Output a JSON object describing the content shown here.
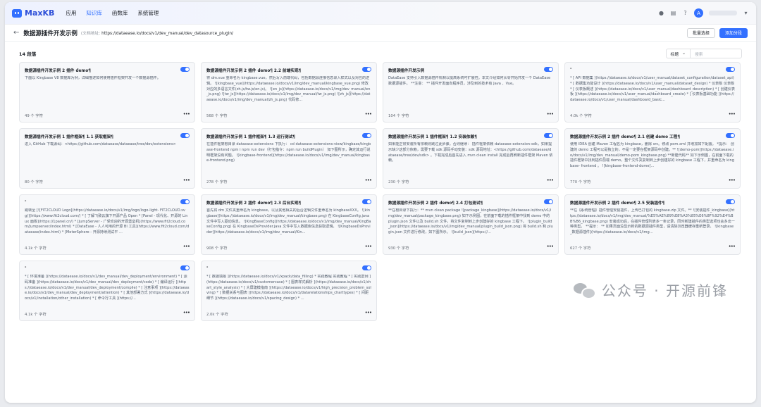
{
  "app": {
    "logo_text": "MaxKB",
    "brand_color": "#3370ff"
  },
  "nav": {
    "items": [
      "应用",
      "知识库",
      "函数库",
      "系统管理"
    ],
    "active_index": 1
  },
  "top_right": {
    "icons": [
      "github-icon",
      "document-icon",
      "help-icon"
    ],
    "avatar_initial": "A"
  },
  "header": {
    "title": "数据源插件开发示例",
    "subtitle_prefix": "(文档地址:",
    "doc_url": "https://dataease.io/docs/v1/dev_manual/dev_datasource_plugin/",
    "batch_button": "批量选择",
    "add_button": "添加分段"
  },
  "list": {
    "count_label": "14 段落",
    "filter_select": "标题",
    "search_placeholder": "搜索"
  },
  "cards": [
    {
      "title": "数据源插件开发示例 2 插件 demo¶",
      "body": "下面以 Kingbase V8 数据库为例，详细描述如何使用插件框架开发一个数据源插件。",
      "chars": "49 个 字符"
    },
    {
      "title": "数据源插件开发示例 2 插件 demo¶ 2.2 前端实现¶",
      "body": "将 dm.vue 重命名为 kingbase.vue，然后写入前端代码，包括数据源连接信息录入样式以及对应的逻辑。 ![kingbase_vue](https://dataease.io/docs/v1/img/dev_manual/kingbase_vue.png) 修改对应的多语言文件(zh.js/tw.js/en.js)。 ![en_js](https://dataease.io/docs/v1/img/dev_manual/en_js.png) ![tw_js](https://dataease.io/docs/v1/img/dev_manual/tw_js.png) ![zh_js](https://dataease.io/docs/v1/img/dev_manual/zh_js.png) 代码修...",
      "chars": "568 个 字符"
    },
    {
      "title": "数据源插件开发示例",
      "body": "DataEase 支持引入数据源插件机制以提高系统可扩展性。本文介绍如何从零开始开发一个 DataEase 数据源插件。 **注意： ** 插件开发面向程序员，涉及到的技术有 Java 、Vue。",
      "chars": "104 个 字符"
    },
    {
      "title": "-",
      "body": "* [ API 数据集 ](https://dataease.io/docs/v1/user_manual/dataset_configuration/dataset_api) * [ 数据集功能设计 ](https://dataease.io/docs/v1/user_manual/dataset_design) * 仪表板 仪表板 * [ 仪表板概述 ](https://dataease.io/docs/v1/user_manual/dashboard_description) * [ 创建仪表板 ](https://dataease.io/docs/v1/user_manual/dashboard_create) * [ 仪表板基础功能 ](https://dataease.io/docs/v1/user_manual/dashboard_basic...",
      "chars": "4.0k 个 字符"
    },
    {
      "title": "数据源插件开发示例 1 插件框架¶ 1.1 获取框架¶",
      "body": "进入 GitHub 下载源码：<https://github.com/dataease/dataease/tree/dev/extensions>",
      "chars": "80 个 字符"
    },
    {
      "title": "数据源插件开发示例 1 插件框架¶ 1.3 运行测试¶",
      "body": "在插件框架根目录 dataease-extensions 下执行： cd dataease-extensions-view/kingbase/kingbase-frontend npm i npm run dev（打包指令：npm run buildPlugin） 如下图所示，确定其运行说明框架没有问题。 ![kingbase-frontend](https://dataease.io/docs/v1/img/dev_manual/kingbase-frontend.png)",
      "chars": "278 个 字符"
    },
    {
      "title": "数据源插件开发示例 1 插件框架¶ 1.2 安装依赖¶",
      "body": "如果能正常安装所有依赖则跳过此步骤。否则继续： 插件框架依赖 dataease-extension-sdk，如果提示缺少这部分依赖，需要下载 sdk 源码手动安装：sdk 源码地址：<https://github.com/dataease/dataease/tree/dev/sdk> 。下载完成后首先进入 mvn clean install 完成后再刷新插件框架 Maven 依赖。",
      "chars": "230 个 字符"
    },
    {
      "title": "数据源插件开发示例 2 插件 demo¶ 2.1 创建 demo 工程¶",
      "body": "使用 IDEA 创建 Maven 工程名为 kingbase，删除 src。修改 pom.xml 并增加如下配置。 *提示： 创建的 demo 工程可以是独立的，不是一定要在框架源码中创建。** ![demo-pom](https://dataease.io/docs/v1/img/dev_manual/demo-pom_kingbase.png) **新建代码** 如下示例图，在前面下载的插件框架中找到插件前端 demo，整个文件夹复制到上步创建好的 kingbase 工程下，并重命名为 kingbase- frontend 。 ![kingbase-frontend-dome]...",
      "chars": "770 个 字符"
    },
    {
      "title": "-",
      "body": "跳转至 [![FIT2CLOUD Logo](https://dataease.io/docs/v1/img/logo/logo-light- FIT2CLOUD.svg)](https://www.fit2cloud.com/) * [ 了解飞致云旗下开源产品 Open * [Panel - 现代化、开源的 Linux 面板](https://1panel.cn/) * [JumpServer - 广受欢迎的开源堡垒机](https://www.fit2cloud.com/jumpserver/index.html) * [DataEase - 人人可用的开源 BI 工具](https://www.fit2cloud.com/dataease/index.html) * [MeterSphere - 开源持续测试平 ...",
      "chars": "4.1k 个 字符"
    },
    {
      "title": "数据源插件开发示例 2 插件 demo¶ 2.3 后台实现¶",
      "body": "首先将 dm 文件夹重命名为 kingbase，以及其他相关的后台逻辑文件重命名为 kingbaseXXX。 ![kingbase](https://dataease.io/docs/v1/img/dev_manual/kingbase.png) 在 KingbaseConfig.java 文件中写入驱动信息。 ![KingBaseConfig](https://dataease.io/docs/v1/img/dev_manual/KingBaseConfig.png) 在 KingbaseDsProvider.java 文件中写入数据库信息获取逻辑。 ![KingbaseDsProvider](https://dataease.io/docs/v1/img/dev_manual/Kin...",
      "chars": "908 个 字符"
    },
    {
      "title": "数据源插件开发示例 2 插件 demo¶ 2.4 打包测试¶",
      "body": "**在根目录下执行：** mvn clean package ![package_kingbase](https://dataease.io/docs/v1/img/dev_manual/package_kingbase.png) 如下示例图，在前面下载的插件框架中找到 demo 中的 plugin.json 文件以及 build.sh 文件，将文件复制到上步创建好的 kingbase 工程下。 ![plugin_build_json](https://dataease.io/docs/v1/img/dev_manual/plugin_build_json.png) 将 build.sh 和 plugin.json 文件进行修改，如下图所示。 ![build_json](https://...",
      "chars": "930 个 字符"
    },
    {
      "title": "数据源插件开发示例 2 插件 demo¶ 2.5 安装插件¶",
      "body": "**在【系统管理】插件管理安装插件，上传已打包的 kingbase.zip 文件。** ![安装插件_kingbase](https://dataease.io/docs/v1/img/dev_manual/%E5%AE%89%E8%A3%85%E6%8F%92%E4%BB%B6_kingbase.png) 安装成功后，在插件管理列表多一条记录，同时新建插件的类型选项也会多出一种类型。 **提示： ** 如果页面没显示新的数据源插件类型，请清除浏览器缓存重新登录。 ![kingbase_数据源插件](https://dataease.io/docs/v1/img...",
      "chars": "627 个 字符"
    },
    {
      "title": "-",
      "body": "* [ 环境准备 ](https://dataease.io/docs/v1/dev_manual/dev_deployment/environment) * [ 源码准备 ](https://dataease.io/docs/v1/dev_manual/dev_deployment/code) * [ 编译运行 ](https://dataease.io/docs/v1/dev_manual/dev_deployment/compile) * [ 注意事项 ](https://dataease.io/docs/v1/dev_manual/dev_deployment/attention) * [ 其他部署方式 ](https://dataease.io/docs/v1/installation/other_installation) * [ 命令行工具 ](https://...",
      "chars": "4.1k 个 字符"
    },
    {
      "title": "-",
      "body": "* [ 数据填报 ](https://dataease.io/docs/v1/xpack/data_filling) * 实践教程 实践教程 * [ 实践案例 ](https://dataease.io/docs/v1/customercase) * [ 图表样式解析 ](https://dataease.io/docs/v1/chart_style_analysis) * [ 大屏建模指南 ](https://dataease.io/docs/v1/high_precision_problem_solving) * [ 数据关系与图表 ](https://dataease.io/docs/v1/datarelationships_charttypes) * [ 间距细节 ](https://dataease.io/docs/v1/spacing_design) * ...",
      "chars": "2.0k 个 字符"
    }
  ],
  "watermark": {
    "text": "公众号 · 开源前锋"
  }
}
